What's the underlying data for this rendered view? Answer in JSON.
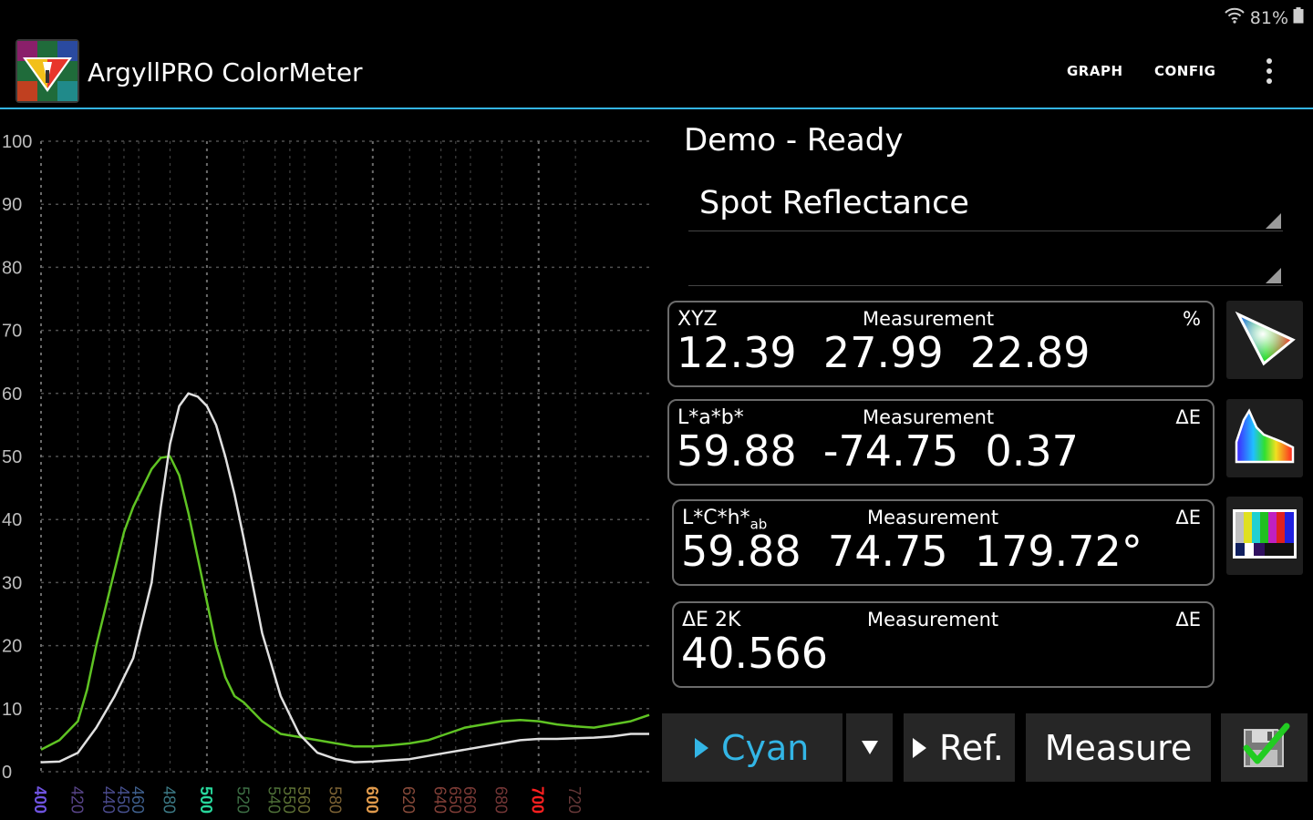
{
  "status_bar": {
    "battery": "81%",
    "wifi_icon": "wifi-icon",
    "battery_icon": "battery-icon"
  },
  "app_bar": {
    "title": "ArgyllPRO ColorMeter",
    "actions": [
      {
        "label": "GRAPH"
      },
      {
        "label": "CONFIG"
      }
    ],
    "overflow_icon": "more-vert-icon"
  },
  "colors": {
    "accent": "#33b5e5",
    "cyan_text": "#33b5e5",
    "current_curve": "#5fc323",
    "reference_curve": "#e0e0e0",
    "check": "#22cc22"
  },
  "status": {
    "text": "Demo - Ready"
  },
  "mode_spinner": {
    "value": "Spot Reflectance"
  },
  "second_spinner": {
    "value": ""
  },
  "readouts": [
    {
      "label": "XYZ",
      "mid": "Measurement",
      "unit": "%",
      "values": "12.39  27.99  22.89"
    },
    {
      "label": "L*a*b*",
      "mid": "Measurement",
      "unit": "ΔE",
      "values": "59.88  -74.75  0.37"
    },
    {
      "label_main": "L*C*h*",
      "label_sub": "ab",
      "mid": "Measurement",
      "unit": "ΔE",
      "values": "59.88  74.75  179.72°"
    },
    {
      "label": "ΔE 2K",
      "mid": "Measurement",
      "unit": "ΔE",
      "values": "40.566"
    }
  ],
  "side_buttons": [
    {
      "icon": "chromaticity-triangle-icon"
    },
    {
      "icon": "spectrum-icon"
    },
    {
      "icon": "color-bars-icon"
    }
  ],
  "bottom_bar": {
    "sample_label": "Cyan",
    "dropdown_icon": "dropdown-arrow-icon",
    "ref_label": "Ref.",
    "measure_label": "Measure",
    "save_icon": "save-check-icon"
  },
  "chart_data": {
    "type": "line",
    "title": "",
    "xlabel": "",
    "ylabel": "",
    "xlim": [
      400,
      730
    ],
    "ylim": [
      0,
      100
    ],
    "grid": true,
    "y_ticks": [
      "0",
      "10",
      "20",
      "30",
      "40",
      "50",
      "60",
      "70",
      "80",
      "90",
      "100"
    ],
    "x_ticks": [
      {
        "label": "400",
        "x": 400,
        "color": "#6f53e0",
        "bold": true
      },
      {
        "label": "420",
        "x": 420,
        "color": "#584488",
        "bold": false
      },
      {
        "label": "440",
        "x": 437,
        "color": "#4a4a8c",
        "bold": false
      },
      {
        "label": "450",
        "x": 445,
        "color": "#46508e",
        "bold": false
      },
      {
        "label": "460",
        "x": 453,
        "color": "#3f608e",
        "bold": false
      },
      {
        "label": "480",
        "x": 470,
        "color": "#3c7a86",
        "bold": false
      },
      {
        "label": "500",
        "x": 490,
        "color": "#28d89c",
        "bold": true
      },
      {
        "label": "520",
        "x": 510,
        "color": "#3d6e44",
        "bold": false
      },
      {
        "label": "540",
        "x": 527,
        "color": "#4e7038",
        "bold": false
      },
      {
        "label": "550",
        "x": 535,
        "color": "#5a7034",
        "bold": false
      },
      {
        "label": "560",
        "x": 543,
        "color": "#6a6c32",
        "bold": false
      },
      {
        "label": "580",
        "x": 560,
        "color": "#7c6234",
        "bold": false
      },
      {
        "label": "600",
        "x": 580,
        "color": "#e09a4c",
        "bold": true
      },
      {
        "label": "620",
        "x": 600,
        "color": "#874a3a",
        "bold": false
      },
      {
        "label": "640",
        "x": 617,
        "color": "#834038",
        "bold": false
      },
      {
        "label": "650",
        "x": 625,
        "color": "#7e3c36",
        "bold": false
      },
      {
        "label": "660",
        "x": 633,
        "color": "#7b3a36",
        "bold": false
      },
      {
        "label": "680",
        "x": 650,
        "color": "#743636",
        "bold": false
      },
      {
        "label": "700",
        "x": 670,
        "color": "#ff2020",
        "bold": true
      },
      {
        "label": "720",
        "x": 690,
        "color": "#663838",
        "bold": false
      }
    ],
    "series": [
      {
        "role": "current",
        "color": "#5fc323",
        "x": [
          400,
          410,
          420,
          425,
          430,
          440,
          445,
          450,
          455,
          460,
          465,
          470,
          475,
          480,
          485,
          490,
          495,
          500,
          505,
          510,
          520,
          530,
          540,
          550,
          560,
          570,
          580,
          590,
          600,
          610,
          620,
          630,
          640,
          650,
          660,
          670,
          680,
          690,
          700,
          710,
          720,
          730
        ],
        "y": [
          3.5,
          5,
          8,
          13,
          20,
          32,
          38,
          42,
          45,
          48,
          49.8,
          50,
          47,
          41,
          34,
          27,
          20,
          15,
          12,
          11,
          8,
          6,
          5.5,
          5,
          4.5,
          4,
          4,
          4.2,
          4.5,
          5,
          6,
          7,
          7.5,
          8,
          8.2,
          8,
          7.5,
          7.2,
          7,
          7.5,
          8,
          9
        ]
      },
      {
        "role": "reference",
        "color": "#e0e0e0",
        "x": [
          400,
          410,
          420,
          430,
          440,
          450,
          460,
          465,
          470,
          475,
          480,
          485,
          490,
          495,
          500,
          505,
          510,
          520,
          530,
          540,
          550,
          560,
          570,
          580,
          590,
          600,
          610,
          620,
          630,
          640,
          650,
          660,
          670,
          680,
          690,
          700,
          710,
          720,
          730
        ],
        "y": [
          1.5,
          1.6,
          3,
          7,
          12,
          18,
          30,
          42,
          52,
          58,
          60,
          59.5,
          58,
          55,
          50,
          44,
          37,
          22,
          12,
          6,
          3,
          2,
          1.5,
          1.6,
          1.8,
          2,
          2.5,
          3,
          3.5,
          4,
          4.5,
          5,
          5.2,
          5.2,
          5.3,
          5.4,
          5.6,
          6,
          6
        ]
      }
    ]
  }
}
